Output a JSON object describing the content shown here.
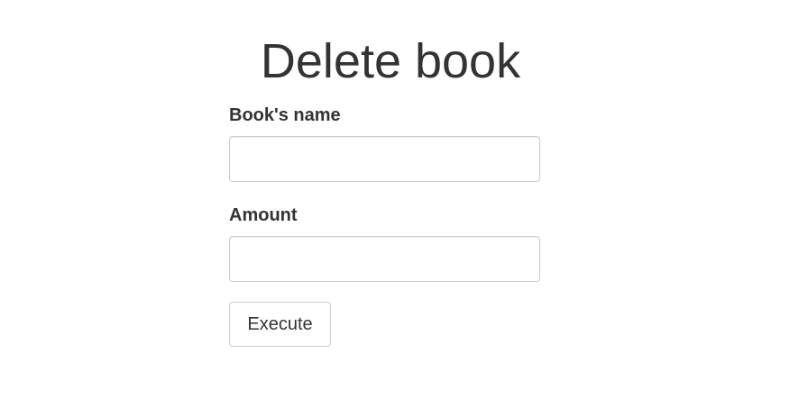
{
  "page": {
    "title": "Delete book"
  },
  "form": {
    "book_name": {
      "label": "Book's name",
      "value": "",
      "placeholder": ""
    },
    "amount": {
      "label": "Amount",
      "value": "",
      "placeholder": ""
    },
    "submit_label": "Execute"
  }
}
